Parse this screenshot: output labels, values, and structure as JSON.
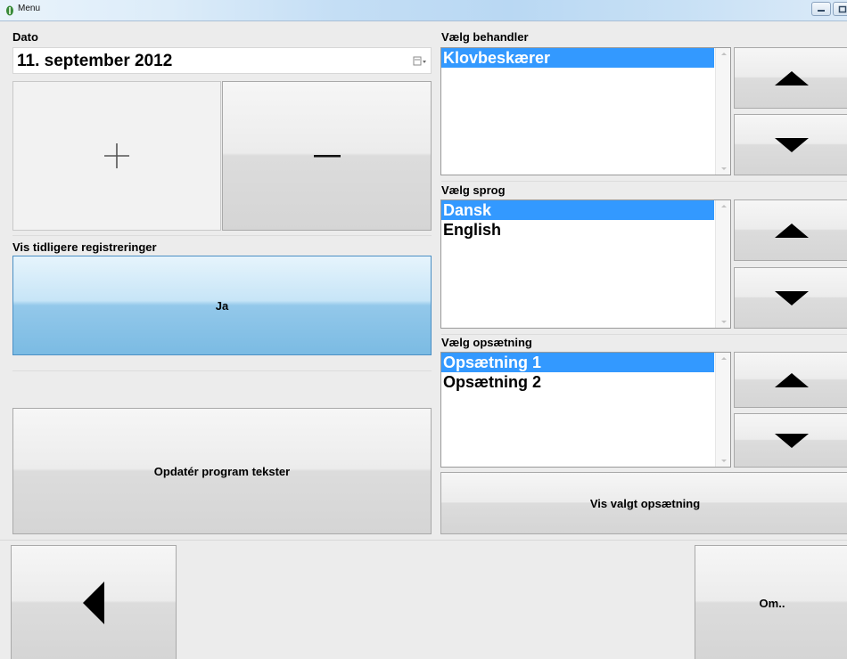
{
  "window": {
    "title": "Menu"
  },
  "date": {
    "label": "Dato",
    "value": "11. september 2012",
    "plus": "+"
  },
  "previous": {
    "label": "Vis tidligere registreringer",
    "button": "Ja"
  },
  "update": {
    "button": "Opdatér program tekster"
  },
  "treater": {
    "label": "Vælg behandler",
    "items": [
      "Klovbeskærer"
    ],
    "selected": 0
  },
  "language": {
    "label": "Vælg sprog",
    "items": [
      "Dansk",
      "English"
    ],
    "selected": 0
  },
  "setup": {
    "label": "Vælg opsætning",
    "items": [
      "Opsætning 1",
      "Opsætning 2"
    ],
    "selected": 0,
    "show_button": "Vis valgt opsætning"
  },
  "about": {
    "button": "Om.."
  },
  "icons": {
    "app": "app-icon",
    "minimize": "minimize-icon",
    "maximize": "maximize-icon",
    "plus": "plus-icon",
    "minus": "minus-icon",
    "up": "triangle-up-icon",
    "down": "triangle-down-icon",
    "back": "triangle-left-icon",
    "calendar": "calendar-dropdown-icon"
  },
  "colors": {
    "selection": "#3399ff",
    "active_button": "#7bbbe3"
  }
}
